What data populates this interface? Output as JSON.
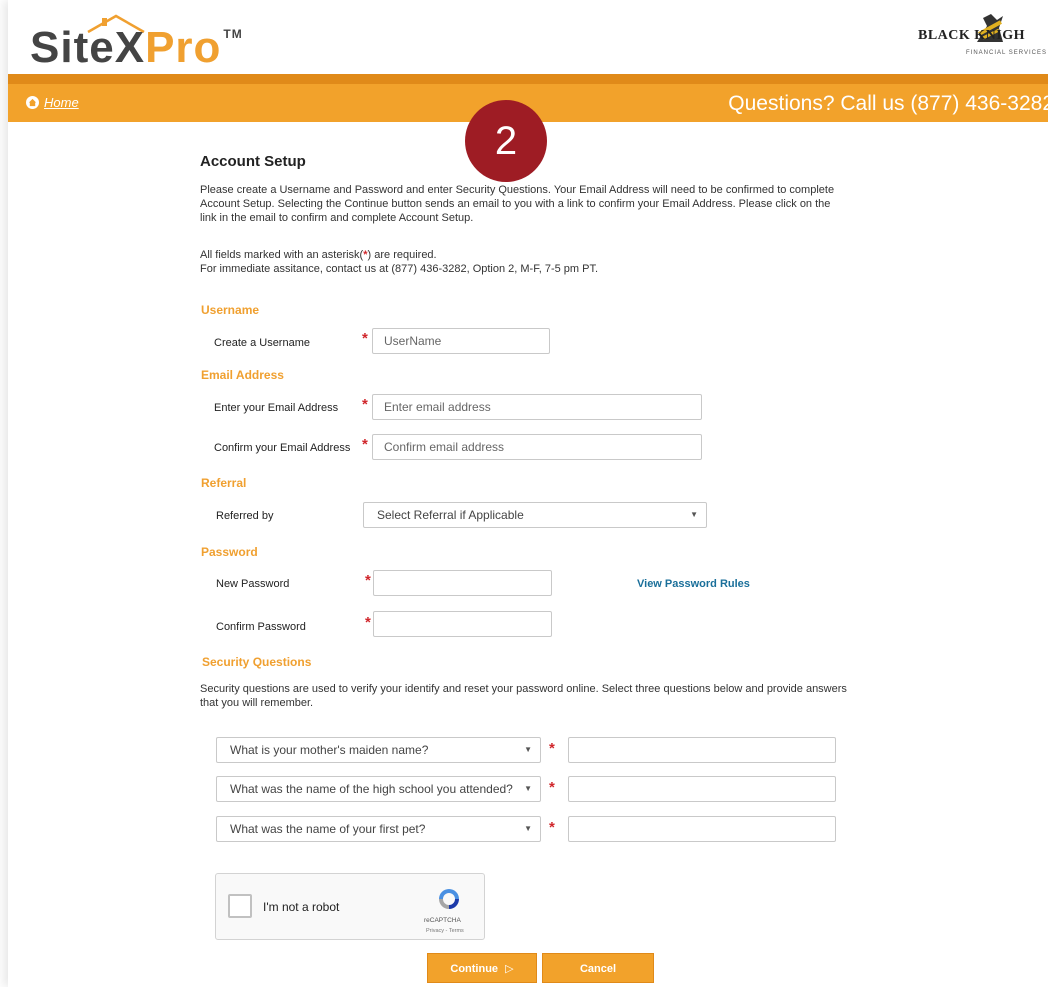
{
  "brand": {
    "logo_site": "Site",
    "logo_x": "X",
    "logo_pro": "Pro",
    "logo_tm": "TM",
    "partner_name": "BLACK KNIGH",
    "partner_sub": "FINANCIAL SERVICES"
  },
  "nav": {
    "home": "Home",
    "phone": "Questions? Call us (877) 436-3282"
  },
  "step": "2",
  "page": {
    "title": "Account Setup",
    "intro": "Please create a Username and Password and enter Security Questions. Your Email Address will need to be confirmed to complete Account Setup. Selecting the Continue button sends an email to you with a link to confirm your Email Address. Please click on the link in the email to confirm and complete Account Setup.",
    "required_note_pre": "All fields marked with an asterisk(",
    "required_star": "*",
    "required_note_post": ") are required.",
    "assist_note": "For immediate assitance, contact us at (877) 436-3282, Option 2, M-F, 7-5 pm PT."
  },
  "username": {
    "section": "Username",
    "label": "Create a Username",
    "placeholder": "UserName"
  },
  "email": {
    "section": "Email Address",
    "label": "Enter your Email Address",
    "placeholder": "Enter email address",
    "confirm_label": "Confirm your Email Address",
    "confirm_placeholder": "Confirm email address"
  },
  "referral": {
    "section": "Referral",
    "label": "Referred by",
    "selected": "Select Referral if Applicable"
  },
  "password": {
    "section": "Password",
    "new_label": "New Password",
    "confirm_label": "Confirm Password",
    "rules_link": "View Password Rules"
  },
  "security": {
    "section": "Security Questions",
    "description": "Security questions are used to verify your identify and reset your password online. Select three questions below and provide answers that you will remember.",
    "questions": [
      "What is your mother's maiden name?",
      "What was the name of the high school you attended?",
      "What was the name of your first pet?"
    ]
  },
  "captcha": {
    "label": "I'm not a robot",
    "brand": "reCAPTCHA",
    "terms": "Privacy - Terms"
  },
  "buttons": {
    "continue": "Continue",
    "cancel": "Cancel"
  },
  "required_marker": "*",
  "colors": {
    "orange": "#f2a22b",
    "orange_dark": "#e08a19",
    "badge": "#9e1c24",
    "required": "#d0262b",
    "link": "#1a6f9a"
  }
}
